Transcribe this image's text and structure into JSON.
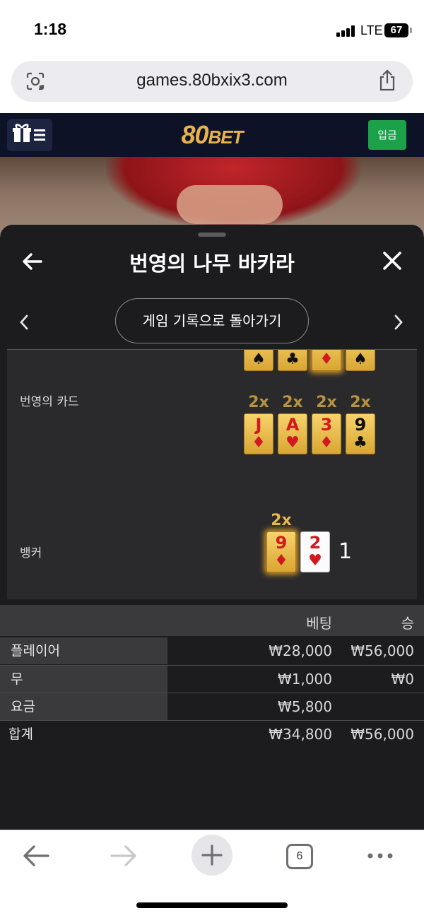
{
  "status_bar": {
    "time": "1:18",
    "network": "LTE",
    "battery": "67"
  },
  "browser": {
    "url": "games.80bxix3.com",
    "tab_count": "6"
  },
  "site": {
    "logo_num": "80",
    "logo_text": "BET",
    "deposit_label": "입금"
  },
  "modal": {
    "title": "번영의 나무 바카라",
    "history_button": "게임 기록으로 돌아가기",
    "prosperity_label": "번영의 카드",
    "banker_label": "뱅커",
    "top_row_suits": [
      "♠",
      "♣",
      "♦",
      "♠"
    ],
    "prosperity_cards": [
      {
        "rank": "J",
        "suit": "♦",
        "color": "red",
        "mult": "2x"
      },
      {
        "rank": "A",
        "suit": "♥",
        "color": "red",
        "mult": "2x"
      },
      {
        "rank": "3",
        "suit": "♦",
        "color": "red",
        "mult": "2x"
      },
      {
        "rank": "9",
        "suit": "♣",
        "color": "black",
        "mult": "2x"
      }
    ],
    "banker_cards": [
      {
        "rank": "9",
        "suit": "♦",
        "color": "red",
        "mult": "2x",
        "style": "gold"
      },
      {
        "rank": "2",
        "suit": "♥",
        "color": "red",
        "style": "white"
      }
    ],
    "banker_score": "1"
  },
  "bets": {
    "header_bet": "베팅",
    "header_win": "승",
    "rows": [
      {
        "label": "플레이어",
        "bet": "₩28,000",
        "win": "₩56,000"
      },
      {
        "label": "무",
        "bet": "₩1,000",
        "win": "₩0"
      },
      {
        "label": "요금",
        "bet": "₩5,800",
        "win": ""
      }
    ],
    "total": {
      "label": "합계",
      "bet": "₩34,800",
      "win": "₩56,000"
    }
  },
  "colors": {
    "modal_bg": "#1c1c1e",
    "gold": "#e8b94c",
    "deposit_green": "#1aa14a",
    "header_navy": "#0d1226"
  }
}
